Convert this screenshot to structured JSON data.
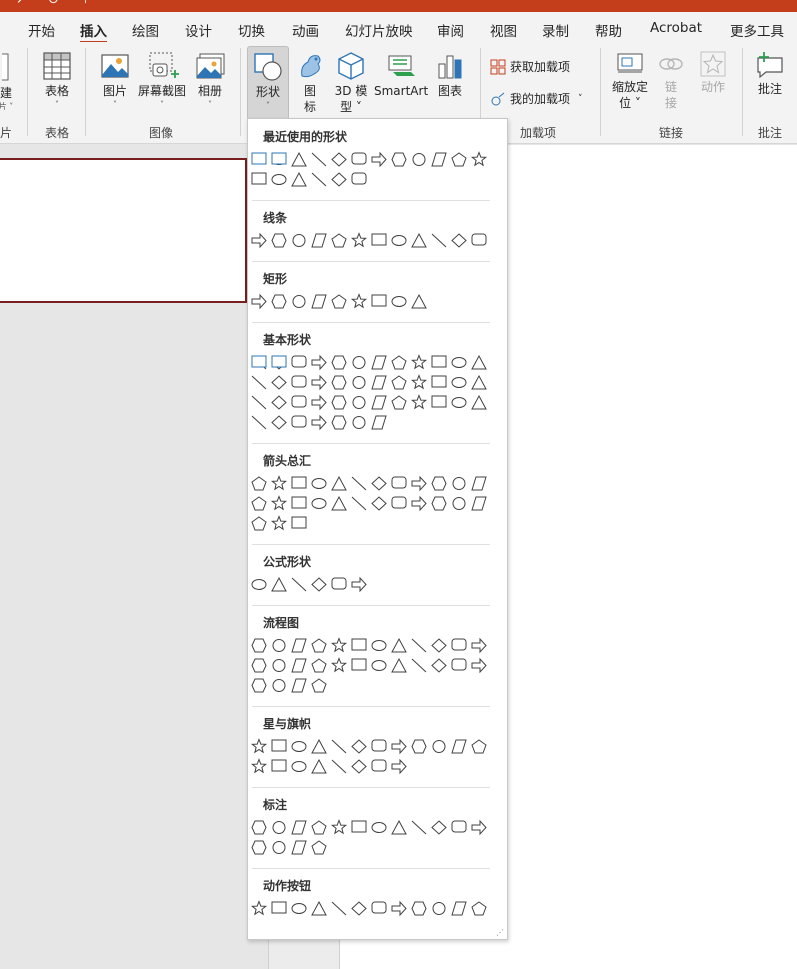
{
  "tabs": [
    {
      "label": "开始",
      "active": false
    },
    {
      "label": "插入",
      "active": true
    },
    {
      "label": "绘图",
      "active": false
    },
    {
      "label": "设计",
      "active": false
    },
    {
      "label": "切换",
      "active": false
    },
    {
      "label": "动画",
      "active": false
    },
    {
      "label": "幻灯片放映",
      "active": false
    },
    {
      "label": "审阅",
      "active": false
    },
    {
      "label": "视图",
      "active": false
    },
    {
      "label": "录制",
      "active": false
    },
    {
      "label": "帮助",
      "active": false
    },
    {
      "label": "Acrobat",
      "active": false
    },
    {
      "label": "更多工具",
      "active": false
    }
  ],
  "ribbon": {
    "partial": {
      "label_1": "建",
      "label_2": "片",
      "group": "片"
    },
    "table": {
      "label": "表格",
      "group": "表格"
    },
    "image": {
      "picture": "图片",
      "screenshot": "屏幕截图",
      "album": "相册",
      "group": "图像"
    },
    "illustrations": {
      "shapes": "形状",
      "icons_1": "图",
      "icons_2": "标",
      "model_1": "3D 模",
      "model_2": "型",
      "smartart": "SmartArt",
      "chart": "图表"
    },
    "addins": {
      "get": "获取加载项",
      "mine": "我的加载项",
      "group": "加载项"
    },
    "links": {
      "zoom_1": "缩放定",
      "zoom_2": "位",
      "link_1": "链",
      "link_2": "接",
      "action": "动作",
      "group": "链接"
    },
    "comments": {
      "label": "批注",
      "group": "批注"
    }
  },
  "shapes_menu": {
    "sections": [
      {
        "title": "最近使用的形状"
      },
      {
        "title": "线条"
      },
      {
        "title": "矩形"
      },
      {
        "title": "基本形状"
      },
      {
        "title": "箭头总汇"
      },
      {
        "title": "公式形状"
      },
      {
        "title": "流程图"
      },
      {
        "title": "星与旗帜"
      },
      {
        "title": "标注"
      },
      {
        "title": "动作按钮"
      }
    ]
  },
  "colors": {
    "accent": "#c43e1c",
    "slide_border": "#7a1f1f",
    "icon_blue": "#2e75b6"
  }
}
